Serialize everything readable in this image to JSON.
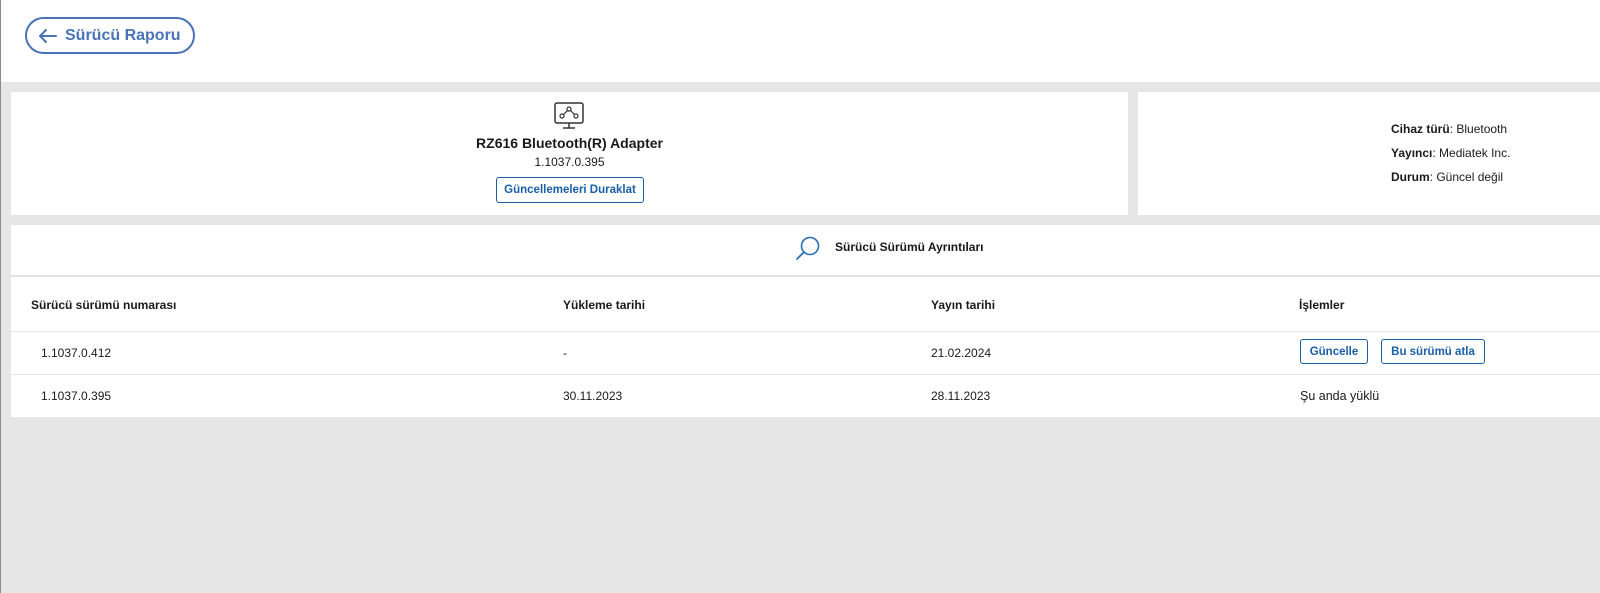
{
  "header": {
    "back_label": "Sürücü Raporu"
  },
  "device": {
    "icon": "network-device-icon",
    "name": "RZ616 Bluetooth(R) Adapter",
    "version": "1.1037.0.395",
    "pause_label": "Güncellemeleri Duraklat"
  },
  "info": {
    "type_label": "Cihaz türü",
    "type_value": "Bluetooth",
    "publisher_label": "Yayıncı",
    "publisher_value": "Mediatek Inc.",
    "status_label": "Durum",
    "status_value": "Güncel değil"
  },
  "details": {
    "title": "Sürücü Sürümü Ayrıntıları",
    "columns": [
      "Sürücü sürümü numarası",
      "Yükleme tarihi",
      "Yayın tarihi",
      "İşlemler"
    ],
    "rows": [
      {
        "version": "1.1037.0.412",
        "install_date": "-",
        "release_date": "21.02.2024",
        "update_label": "Güncelle",
        "skip_label": "Bu sürümü atla"
      },
      {
        "version": "1.1037.0.395",
        "install_date": "30.11.2023",
        "release_date": "28.11.2023",
        "action_text": "Şu anda yüklü"
      }
    ]
  },
  "colors": {
    "accent": "#1a5fa8",
    "back_accent": "#4a72b8",
    "background": "#e6e6e6"
  }
}
